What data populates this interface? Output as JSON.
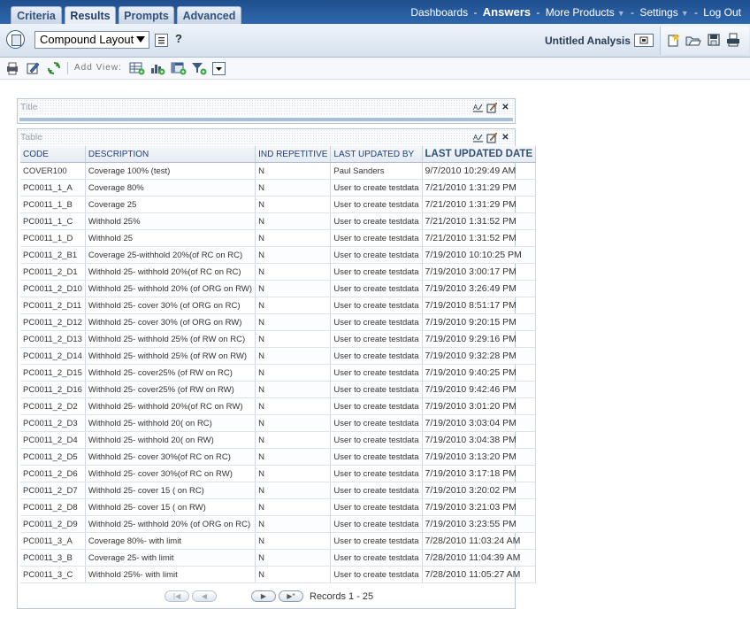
{
  "tabs": [
    "Criteria",
    "Results",
    "Prompts",
    "Advanced"
  ],
  "active_tab": "Results",
  "topnav": {
    "dashboards": "Dashboards",
    "answers": "Answers",
    "more_products": "More Products",
    "settings": "Settings",
    "logout": "Log Out",
    "separator": "-"
  },
  "layout_select": "Compound Layout",
  "analysis_name": "Untitled Analysis",
  "add_view_label": "Add View:",
  "views": {
    "title_view_label": "Title",
    "table_view_label": "Table"
  },
  "table": {
    "headers": [
      "CODE",
      "DESCRIPTION",
      "IND REPETITIVE",
      "LAST UPDATED BY",
      "LAST UPDATED DATE"
    ],
    "rows": [
      [
        "COVER100",
        "Coverage 100% (test)",
        "N",
        "Paul Sanders",
        "9/7/2010 10:29:49 AM"
      ],
      [
        "PC0011_1_A",
        "Coverage 80%",
        "N",
        "User to create testdata",
        "7/21/2010 1:31:29 PM"
      ],
      [
        "PC0011_1_B",
        "Coverage 25",
        "N",
        "User to create testdata",
        "7/21/2010 1:31:29 PM"
      ],
      [
        "PC0011_1_C",
        "Withhold 25%",
        "N",
        "User to create testdata",
        "7/21/2010 1:31:52 PM"
      ],
      [
        "PC0011_1_D",
        "Withhold 25",
        "N",
        "User to create testdata",
        "7/21/2010 1:31:52 PM"
      ],
      [
        "PC0011_2_B1",
        "Coverage 25-withhold 20%(of RC on RC)",
        "N",
        "User to create testdata",
        "7/19/2010 10:10:25 PM"
      ],
      [
        "PC0011_2_D1",
        "Withhold 25- withhold 20%(of RC on RC)",
        "N",
        "User to create testdata",
        "7/19/2010 3:00:17 PM"
      ],
      [
        "PC0011_2_D10",
        "Withhold 25- withhold 20% (of ORG on RW)",
        "N",
        "User to create testdata",
        "7/19/2010 3:26:49 PM"
      ],
      [
        "PC0011_2_D11",
        "Withhold 25- cover 30% (of ORG on RC)",
        "N",
        "User to create testdata",
        "7/19/2010 8:51:17 PM"
      ],
      [
        "PC0011_2_D12",
        "Withhold 25- cover 30% (of ORG on RW)",
        "N",
        "User to create testdata",
        "7/19/2010 9:20:15 PM"
      ],
      [
        "PC0011_2_D13",
        "Withhold 25- withhold 25% (of RW on RC)",
        "N",
        "User to create testdata",
        "7/19/2010 9:29:16 PM"
      ],
      [
        "PC0011_2_D14",
        "Withhold 25- withhold 25% (of RW on RW)",
        "N",
        "User to create testdata",
        "7/19/2010 9:32:28 PM"
      ],
      [
        "PC0011_2_D15",
        "Withhold 25- cover25% (of RW on RC)",
        "N",
        "User to create testdata",
        "7/19/2010 9:40:25 PM"
      ],
      [
        "PC0011_2_D16",
        "Withhold 25- cover25% (of RW on RW)",
        "N",
        "User to create testdata",
        "7/19/2010 9:42:46 PM"
      ],
      [
        "PC0011_2_D2",
        "Withhold 25- withhold 20%(of RC on RW)",
        "N",
        "User to create testdata",
        "7/19/2010 3:01:20 PM"
      ],
      [
        "PC0011_2_D3",
        "Withhold 25- withhold 20( on RC)",
        "N",
        "User to create testdata",
        "7/19/2010 3:03:04 PM"
      ],
      [
        "PC0011_2_D4",
        "Withhold 25- withhold 20( on RW)",
        "N",
        "User to create testdata",
        "7/19/2010 3:04:38 PM"
      ],
      [
        "PC0011_2_D5",
        "Withhold 25- cover 30%(of RC on RC)",
        "N",
        "User to create testdata",
        "7/19/2010 3:13:20 PM"
      ],
      [
        "PC0011_2_D6",
        "Withhold 25- cover 30%(of RC on RW)",
        "N",
        "User to create testdata",
        "7/19/2010 3:17:18 PM"
      ],
      [
        "PC0011_2_D7",
        "Withhold 25- cover 15 ( on RC)",
        "N",
        "User to create testdata",
        "7/19/2010 3:20:02 PM"
      ],
      [
        "PC0011_2_D8",
        "Withhold 25- cover 15 ( on RW)",
        "N",
        "User to create testdata",
        "7/19/2010 3:21:03 PM"
      ],
      [
        "PC0011_2_D9",
        "Withhold 25- withhold 20% (of ORG on RC)",
        "N",
        "User to create testdata",
        "7/19/2010 3:23:55 PM"
      ],
      [
        "PC0011_3_A",
        "Coverage 80%- with limit",
        "N",
        "User to create testdata",
        "7/28/2010 11:03:24 AM"
      ],
      [
        "PC0011_3_B",
        "Coverage 25- with limit",
        "N",
        "User to create testdata",
        "7/28/2010 11:04:39 AM"
      ],
      [
        "PC0011_3_C",
        "Withhold 25%- with limit",
        "N",
        "User to create testdata",
        "7/28/2010 11:05:27 AM"
      ]
    ]
  },
  "pager": {
    "records": "Records 1 - 25"
  },
  "colors": {
    "header_blue": "#2a5c9e",
    "link_white": "#ffffff",
    "column_header_text": "#1e3f7a"
  },
  "icons": [
    "layout-icon",
    "properties-icon",
    "help-icon",
    "print-icon",
    "edit-icon",
    "refresh-icon",
    "add-table-view-icon",
    "add-chart-view-icon",
    "add-pivot-view-icon",
    "add-filter-view-icon",
    "new-icon",
    "open-icon",
    "save-icon",
    "print-icon",
    "format-icon",
    "delete-icon",
    "first-page-icon",
    "prev-page-icon",
    "next-page-icon",
    "last-page-icon"
  ]
}
